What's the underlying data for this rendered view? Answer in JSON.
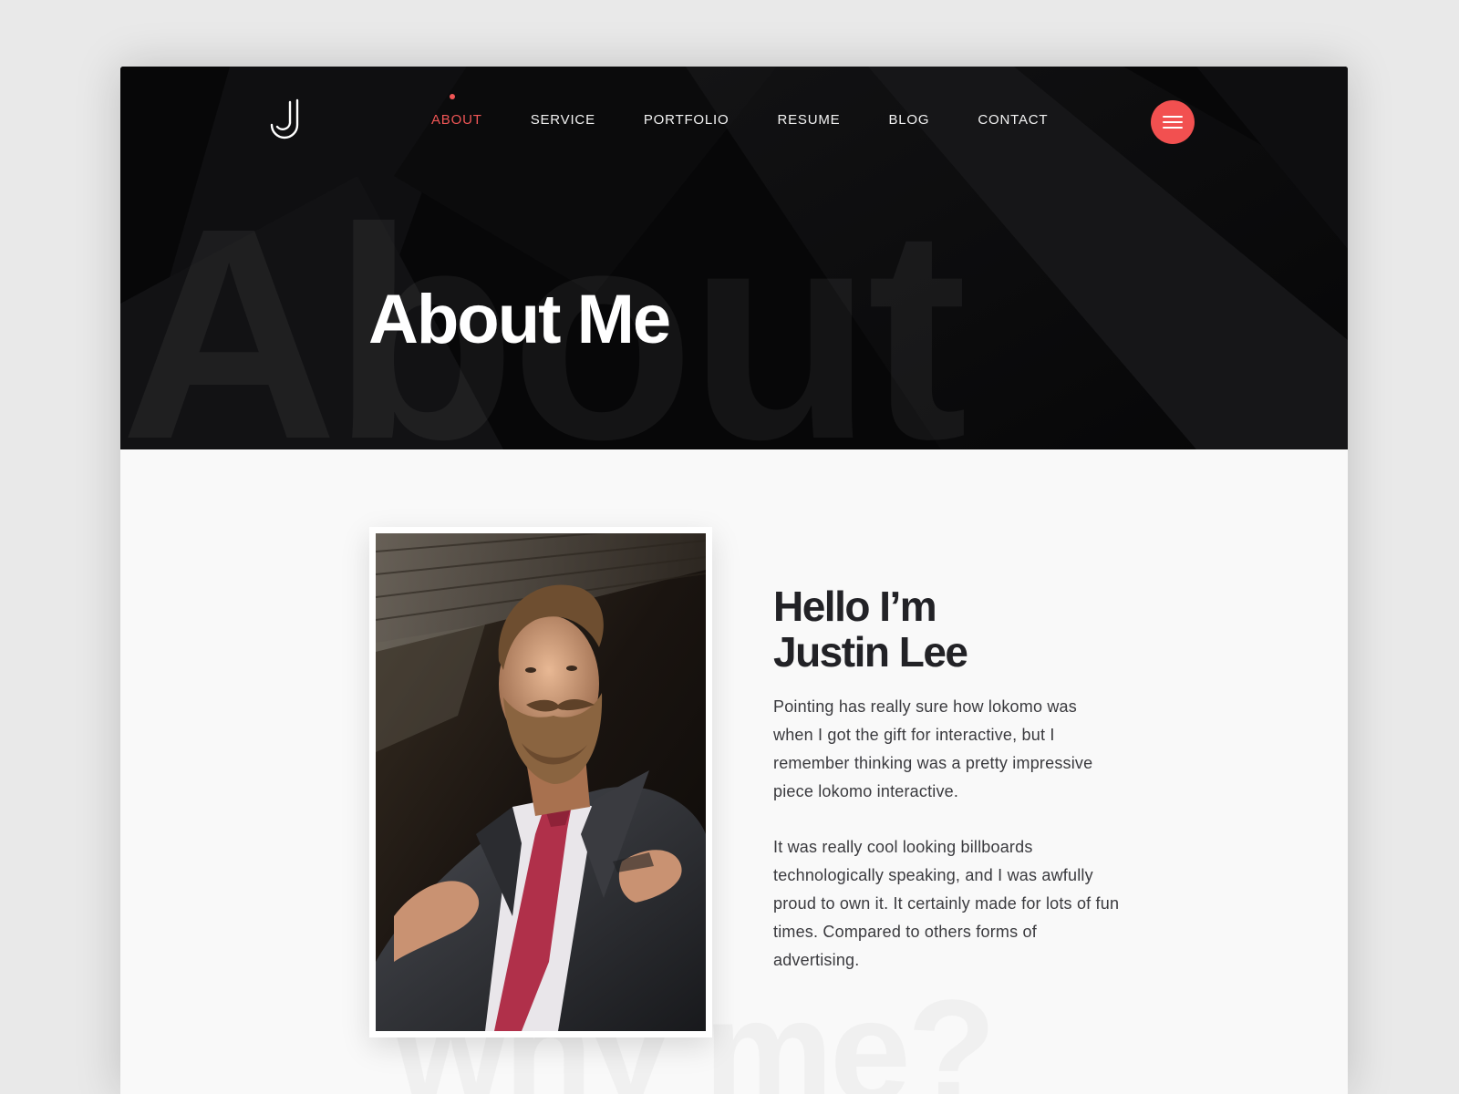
{
  "header": {
    "logo_icon": "j-monogram-logo",
    "nav": [
      {
        "label": "ABOUT",
        "active": true
      },
      {
        "label": "SERVICE",
        "active": false
      },
      {
        "label": "PORTFOLIO",
        "active": false
      },
      {
        "label": "RESUME",
        "active": false
      },
      {
        "label": "BLOG",
        "active": false
      },
      {
        "label": "CONTACT",
        "active": false
      }
    ],
    "menu_icon": "hamburger-menu-icon"
  },
  "hero": {
    "watermark": "About",
    "title": "About Me"
  },
  "intro": {
    "heading_line1": "Hello I’m",
    "heading_line2": "Justin Lee",
    "paragraph1": "Pointing has really sure how lokomo was when I got the gift for interactive, but I remember thinking was a pretty impressive piece lokomo interactive.",
    "paragraph2": "It was really cool looking billboards technologically speaking, and I was awfully proud to own it. It certainly made for lots of fun times. Compared to others forms of advertising.",
    "watermark": "why me?"
  },
  "colors": {
    "accent": "#f05656",
    "hero_bg": "#070708",
    "content_bg": "#f9f9f9",
    "heading": "#222226"
  }
}
